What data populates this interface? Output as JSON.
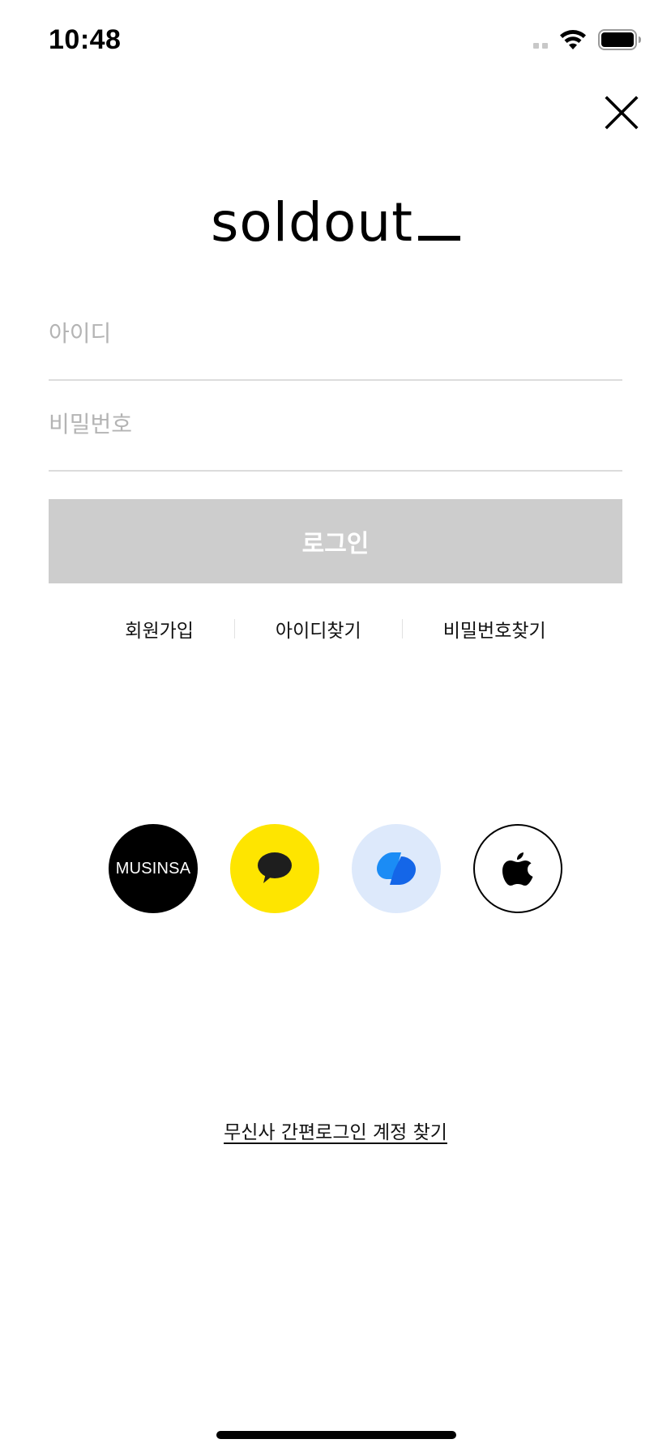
{
  "status_bar": {
    "time": "10:48",
    "icons": [
      "signal-icon",
      "wifi-icon",
      "battery-icon"
    ]
  },
  "header": {
    "close_icon": "close-icon"
  },
  "logo": {
    "text": "soldout"
  },
  "form": {
    "id_placeholder": "아이디",
    "id_value": "",
    "password_placeholder": "비밀번호",
    "password_value": "",
    "login_label": "로그인",
    "login_button_color": "#cdcdcd"
  },
  "links": {
    "signup": "회원가입",
    "find_id": "아이디찾기",
    "find_password": "비밀번호찾기"
  },
  "social": {
    "musinsa_label": "MUSINSA",
    "musinsa_color": "#000000",
    "kakao_color": "#fee500",
    "toss_color": "#dde9fb",
    "apple_color": "#ffffff",
    "icons": [
      "kakao-icon",
      "toss-icon",
      "apple-icon"
    ]
  },
  "footer": {
    "find_account": "무신사 간편로그인 계정 찾기"
  }
}
